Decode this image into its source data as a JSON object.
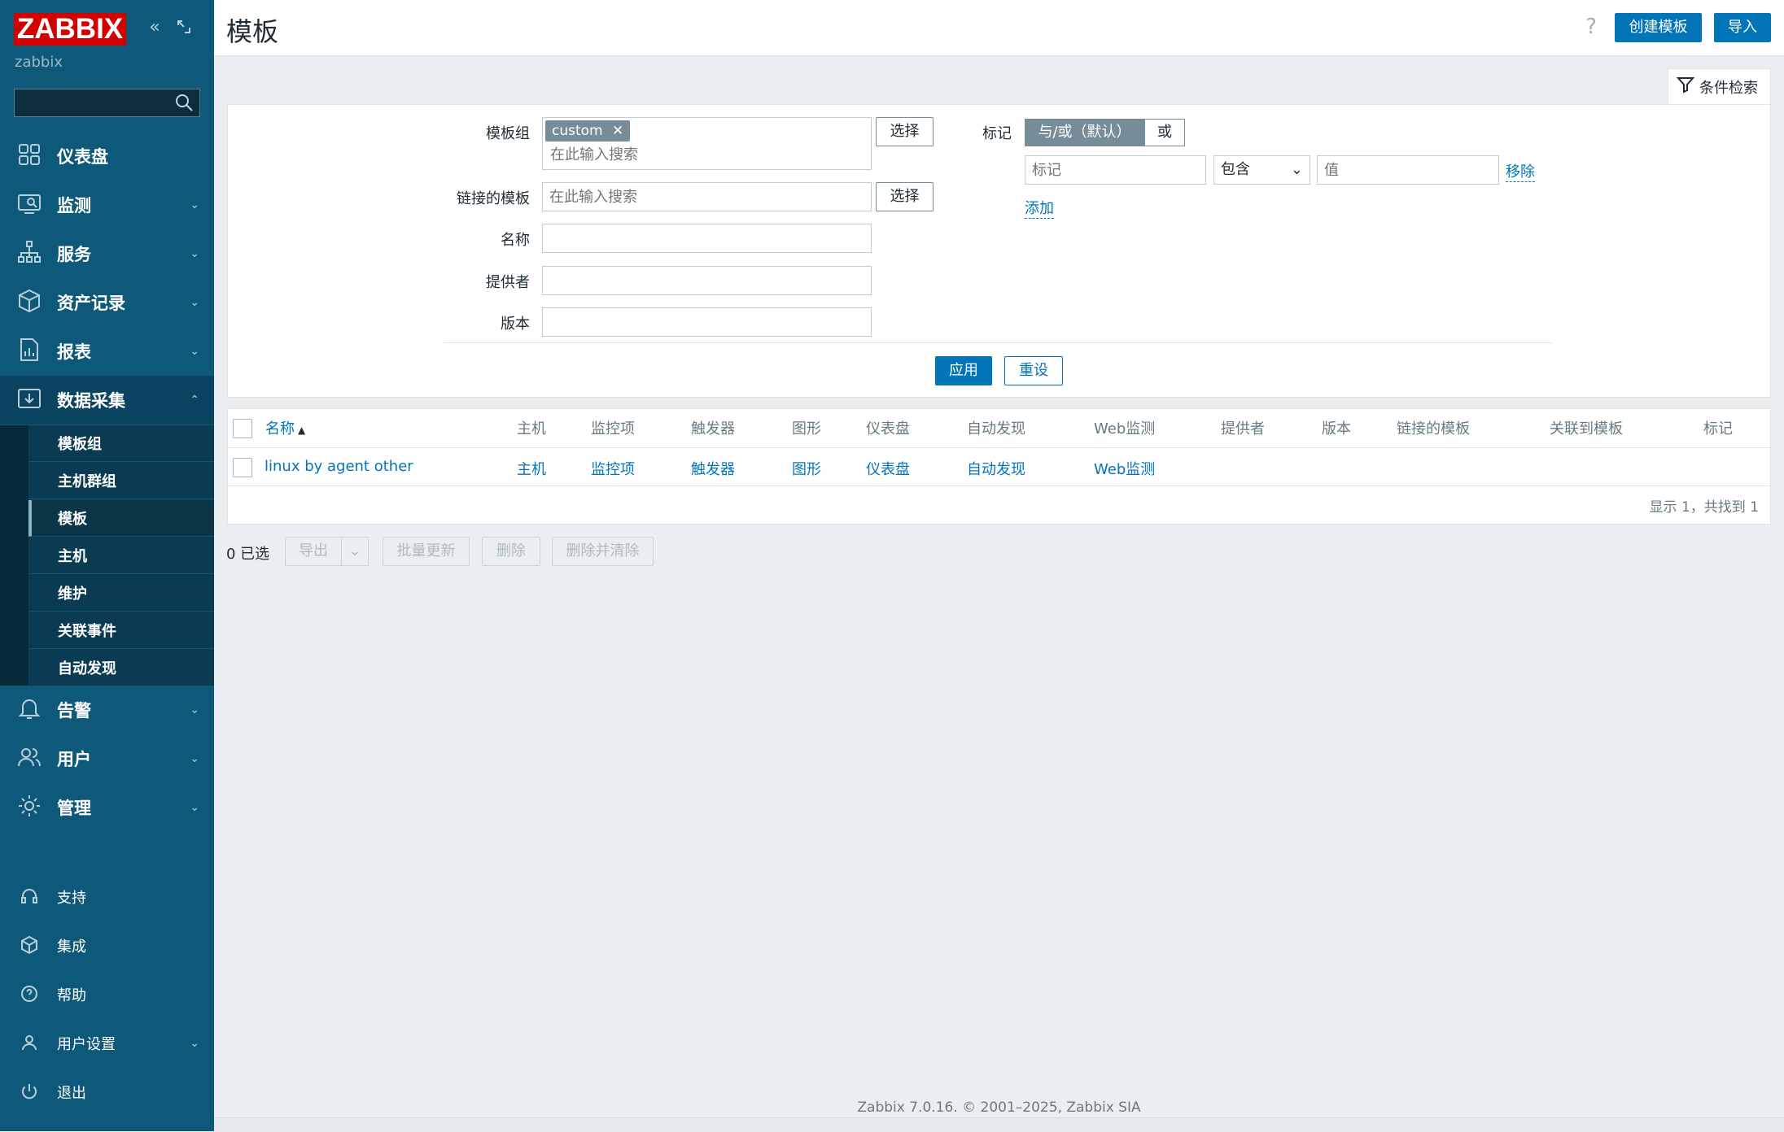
{
  "brand": {
    "logo_text": "ZABBIX",
    "server_name": "zabbix",
    "color": "#d40000"
  },
  "sidebar": {
    "search_placeholder": "",
    "main_items": [
      {
        "label": "仪表盘",
        "icon": "dashboard-icon"
      },
      {
        "label": "监测",
        "icon": "monitoring-icon"
      },
      {
        "label": "服务",
        "icon": "services-icon"
      },
      {
        "label": "资产记录",
        "icon": "inventory-icon"
      },
      {
        "label": "报表",
        "icon": "reports-icon"
      },
      {
        "label": "数据采集",
        "icon": "data-collection-icon"
      },
      {
        "label": "告警",
        "icon": "alerts-icon"
      },
      {
        "label": "用户",
        "icon": "users-icon"
      },
      {
        "label": "管理",
        "icon": "administration-icon"
      }
    ],
    "sub_items": [
      {
        "label": "模板组"
      },
      {
        "label": "主机群组"
      },
      {
        "label": "模板"
      },
      {
        "label": "主机"
      },
      {
        "label": "维护"
      },
      {
        "label": "关联事件"
      },
      {
        "label": "自动发现"
      }
    ],
    "bottom_items": [
      {
        "label": "支持",
        "icon": "support-icon"
      },
      {
        "label": "集成",
        "icon": "integrations-icon"
      },
      {
        "label": "帮助",
        "icon": "help-icon"
      },
      {
        "label": "用户设置",
        "icon": "user-settings-icon"
      },
      {
        "label": "退出",
        "icon": "sign-out-icon"
      }
    ]
  },
  "header": {
    "title": "模板",
    "help": "?",
    "create_button": "创建模板",
    "import_button": "导入"
  },
  "filter": {
    "tab_label": "条件检索",
    "template_group_label": "模板组",
    "template_group_chip": "custom",
    "template_group_placeholder": "在此输入搜索",
    "select_label": "选择",
    "linked_templates_label": "链接的模板",
    "linked_templates_placeholder": "在此输入搜索",
    "name_label": "名称",
    "vendor_label": "提供者",
    "version_label": "版本",
    "tags_label": "标记",
    "tags_and_or": "与/或（默认）",
    "tags_or": "或",
    "tag_placeholder": "标记",
    "tag_operator": "包含",
    "value_placeholder": "值",
    "remove_label": "移除",
    "add_label": "添加",
    "apply_label": "应用",
    "reset_label": "重设"
  },
  "table": {
    "columns": [
      "名称",
      "主机",
      "监控项",
      "触发器",
      "图形",
      "仪表盘",
      "自动发现",
      "Web监测",
      "提供者",
      "版本",
      "链接的模板",
      "关联到模板",
      "标记"
    ],
    "rows": [
      {
        "name": "linux by agent other",
        "hosts": "主机",
        "items": "监控项",
        "triggers": "触发器",
        "graphs": "图形",
        "dashboards": "仪表盘",
        "discovery": "自动发现",
        "web": "Web监测"
      }
    ],
    "summary": "显示 1，共找到 1"
  },
  "actions": {
    "selected": "0 已选",
    "export": "导出",
    "mass_update": "批量更新",
    "delete": "删除",
    "delete_clear": "删除并清除"
  },
  "footer": {
    "copyright": "Zabbix 7.0.16. © 2001–2025, Zabbix SIA"
  }
}
